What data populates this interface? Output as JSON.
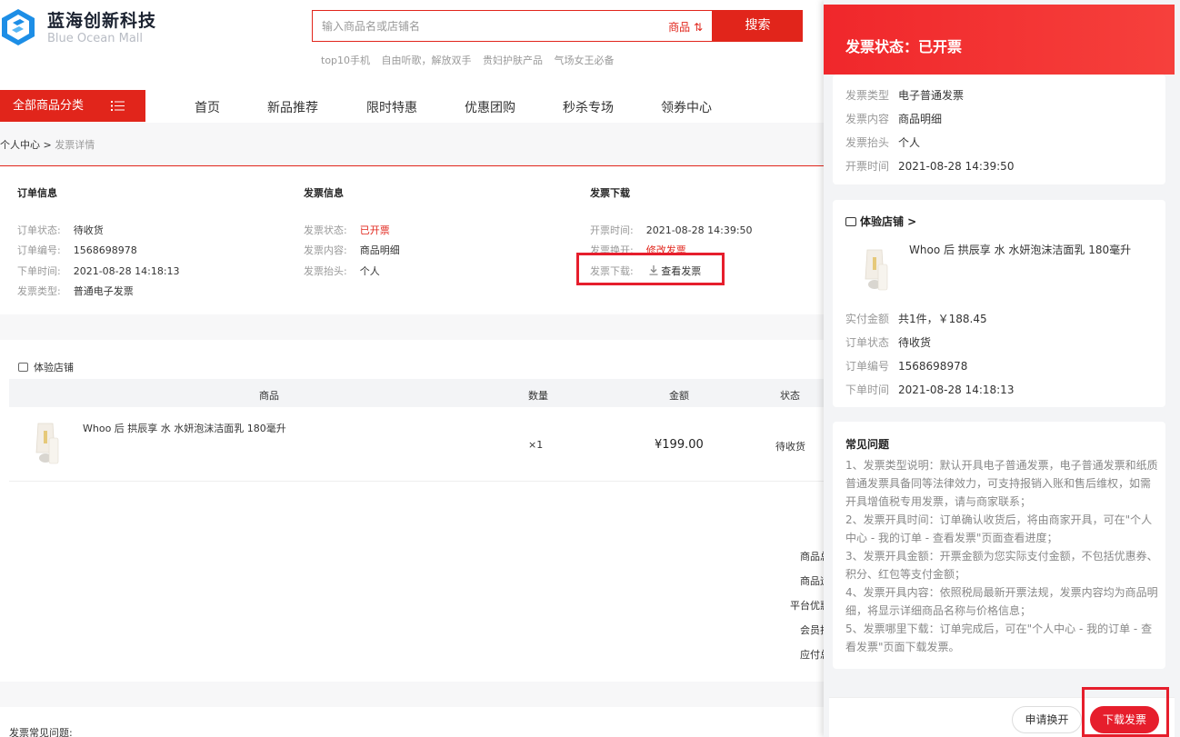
{
  "header": {
    "brand_name": "蓝海创新科技",
    "brand_sub": "Blue Ocean Mall",
    "search_placeholder": "输入商品名或店铺名",
    "search_scope": "商品 ⇅",
    "search_button": "搜索",
    "hot_words": [
      "top10手机",
      "自由听歌，解放双手",
      "贵妇护肤产品",
      "气场女王必备"
    ]
  },
  "nav": {
    "all_categories": "全部商品分类",
    "items": [
      "首页",
      "新品推荐",
      "限时特惠",
      "优惠团购",
      "秒杀专场",
      "领券中心"
    ]
  },
  "breadcrumb": {
    "parent": "个人中心",
    "separator": ">",
    "current": "发票详情"
  },
  "order_info": {
    "title": "订单信息",
    "status_label": "订单状态:",
    "status": "待收货",
    "number_label": "订单编号:",
    "number": "1568698978",
    "time_label": "下单时间:",
    "time": "2021-08-28 14:18:13",
    "type_label": "发票类型:",
    "type": "普通电子发票"
  },
  "invoice_info": {
    "title": "发票信息",
    "status_label": "发票状态:",
    "status": "已开票",
    "content_label": "发票内容:",
    "content": "商品明细",
    "header_label": "发票抬头:",
    "header": "个人"
  },
  "invoice_download": {
    "title": "发票下载",
    "time_label": "开票时间:",
    "time": "2021-08-28 14:39:50",
    "change_label": "发票换开:",
    "change_link": "修改发票",
    "download_label": "发票下载:",
    "download_link": "查看发票"
  },
  "goods": {
    "shop_name": "体验店铺",
    "columns": [
      "商品",
      "数量",
      "金额",
      "状态"
    ],
    "product_name": "Whoo 后 拱辰享 水 水妍泡沫洁面乳 180毫升",
    "qty": "×1",
    "price": "¥199.00",
    "status": "待收货"
  },
  "summary_labels": [
    "商品总",
    "商品运",
    "平台优惠",
    "会员折",
    "应付总"
  ],
  "faq_left": "发票常见问题:",
  "drawer": {
    "title": "发票状态：已开票",
    "invoice": {
      "type_label": "发票类型",
      "type": "电子普通发票",
      "content_label": "发票内容",
      "content": "商品明细",
      "header_label": "发票抬头",
      "header": "个人",
      "time_label": "开票时间",
      "time": "2021-08-28 14:39:50"
    },
    "shop": {
      "name": "体验店铺 >",
      "product_name": "Whoo 后 拱辰享 水 水妍泡沫洁面乳 180毫升",
      "amount_label": "实付金额",
      "amount": "共1件，￥188.45",
      "status_label": "订单状态",
      "status": "待收货",
      "number_label": "订单编号",
      "number": "1568698978",
      "time_label": "下单时间",
      "time": "2021-08-28 14:18:13"
    },
    "faq": {
      "title": "常见问题",
      "lines": [
        "1、发票类型说明：默认开具电子普通发票，电子普通发票和纸质普通发票具备同等法律效力，可支持报销入账和售后维权，如需开具增值税专用发票，请与商家联系；",
        "2、发票开具时间：订单确认收货后，将由商家开具，可在\"个人中心 - 我的订单 - 查看发票\"页面查看进度；",
        "3、发票开具金额：开票金额为您实际支付金额，不包括优惠券、积分、红包等支付金额；",
        "4、发票开具内容：依照税局最新开票法规，发票内容均为商品明细，将显示详细商品名称与价格信息；",
        "5、发票哪里下载：订单完成后，可在\"个人中心 - 我的订单 - 查看发票\"页面下载发票。"
      ]
    },
    "buttons": {
      "change": "申请换开",
      "download": "下载发票"
    }
  },
  "colors": {
    "accent": "#e1251b",
    "highlight": "#e61e2c",
    "muted": "#999999"
  }
}
